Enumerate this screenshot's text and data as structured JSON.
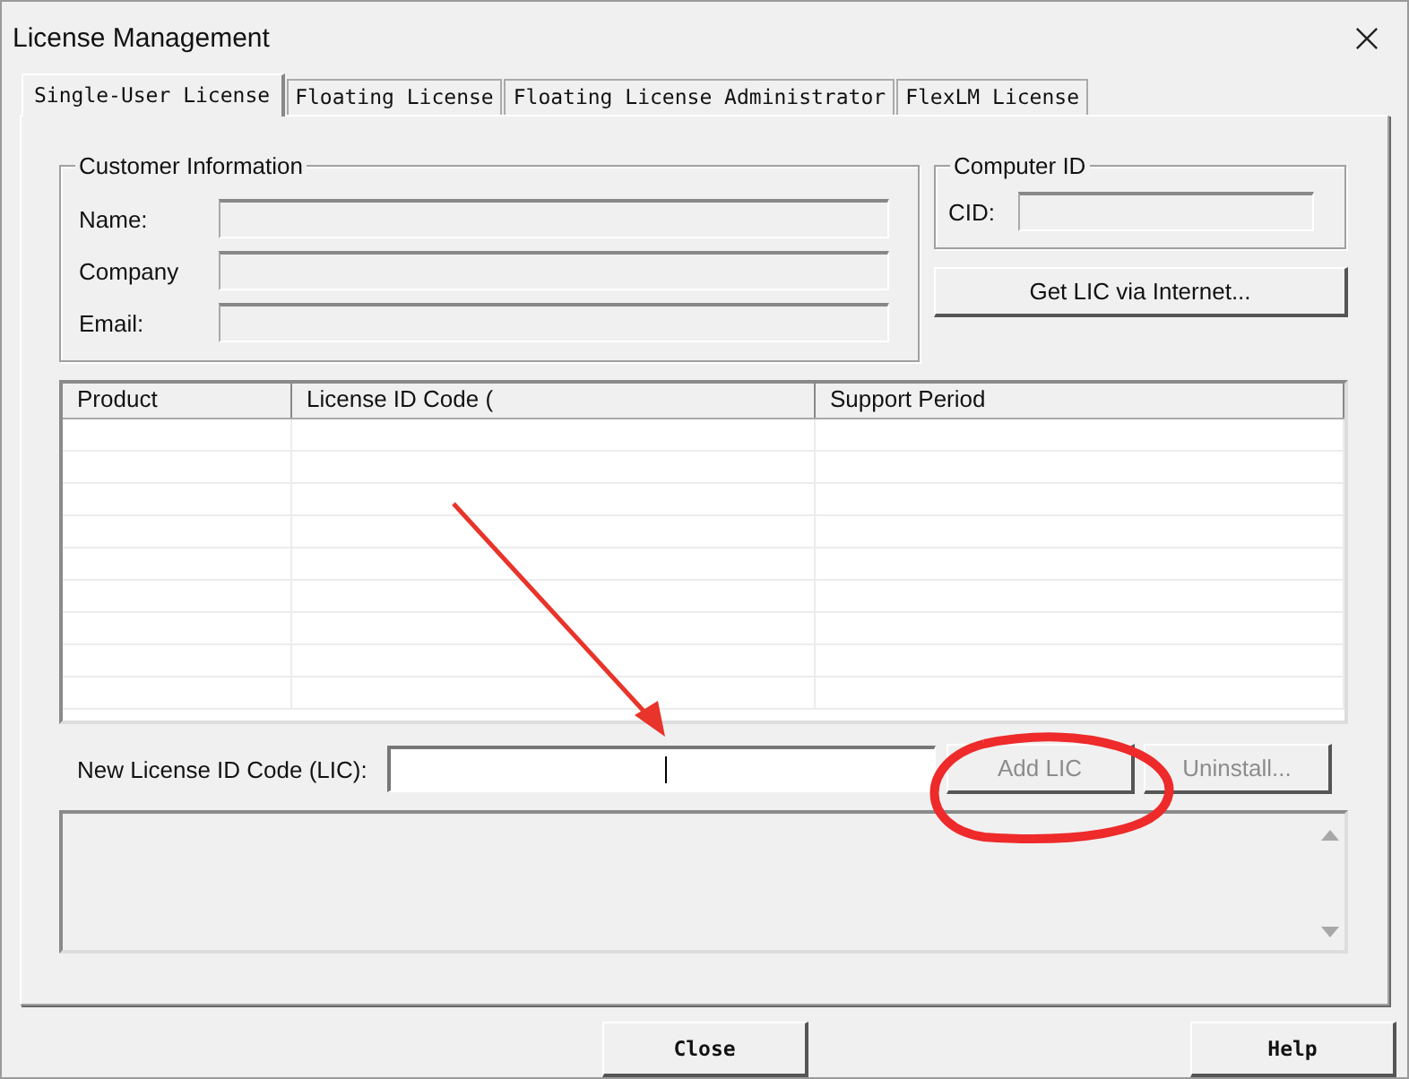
{
  "window": {
    "title": "License Management"
  },
  "tabs": [
    {
      "label": "Single-User License",
      "selected": true
    },
    {
      "label": "Floating License",
      "selected": false
    },
    {
      "label": "Floating License Administrator",
      "selected": false
    },
    {
      "label": "FlexLM License",
      "selected": false
    }
  ],
  "customer_info": {
    "title": "Customer Information",
    "fields": [
      {
        "label": "Name:"
      },
      {
        "label": "Company"
      },
      {
        "label": "Email:"
      }
    ]
  },
  "computer_id": {
    "title": "Computer ID",
    "fields": [
      {
        "label": "CID:"
      }
    ]
  },
  "get_lic_button": {
    "label": "Get LIC via Internet...",
    "disabled": false
  },
  "table": {
    "columns": [
      "Product",
      "License ID Code (",
      "Support Period"
    ]
  },
  "new_lic": {
    "label": "New License ID Code (LIC):"
  },
  "actions": [
    {
      "label": "Add LIC",
      "disabled": true
    },
    {
      "label": "Uninstall...",
      "disabled": true
    }
  ],
  "buttons": [
    {
      "label": "Close"
    },
    {
      "label": "Help"
    }
  ]
}
